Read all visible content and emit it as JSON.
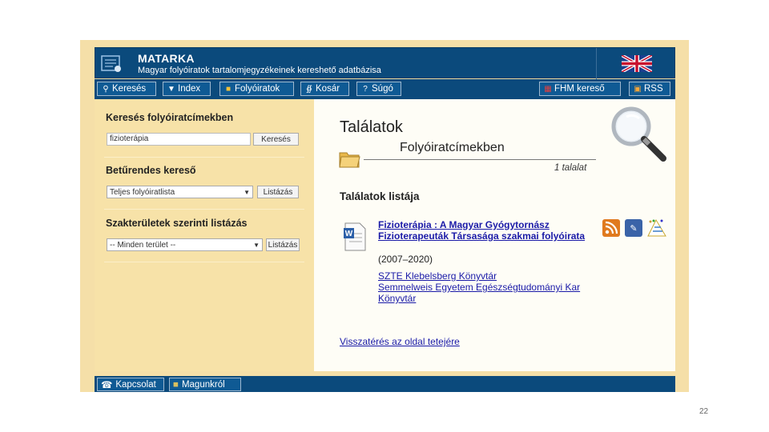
{
  "header": {
    "title": "MATARKA",
    "subtitle": "Magyar folyóiratok tartalomjegyzékeinek kereshető adatbázisa"
  },
  "nav": {
    "items": [
      {
        "label": "Keresés",
        "icon": "magnifier-icon"
      },
      {
        "label": "Index",
        "icon": "funnel-icon"
      },
      {
        "label": "Folyóiratok",
        "icon": "folder-icon"
      },
      {
        "label": "Kosár",
        "icon": "cart-icon"
      },
      {
        "label": "Súgó",
        "icon": "question-icon"
      }
    ],
    "right_items": [
      {
        "label": "FHM kereső",
        "icon": "fhm-icon"
      },
      {
        "label": "RSS",
        "icon": "rss-icon"
      }
    ]
  },
  "sidebar": {
    "search": {
      "title": "Keresés folyóiratcímekben",
      "input_value": "fizioterápia",
      "button": "Keresés"
    },
    "alpha": {
      "title": "Betűrendes kereső",
      "select_value": "Teljes folyóiratlista",
      "button": "Listázás"
    },
    "subject": {
      "title": "Szakterületek szerinti listázás",
      "select_value": "-- Minden terület --",
      "button": "Listázás"
    }
  },
  "main": {
    "title": "Találatok",
    "subtitle": "Folyóiratcímekben",
    "count": "1 talalat",
    "list_title": "Találatok listája",
    "result": {
      "title": "Fizioterápia : A Magyar Gyógytornász Fizioterapeuták Társasága szakmai folyóirata",
      "years": "(2007–2020)",
      "libraries": [
        "SZTE Klebelsberg Könyvtár",
        "Semmelweis Egyetem Egészségtudományi Kar Könyvtár"
      ]
    },
    "back_link": "Visszatérés az oldal tetejére"
  },
  "footer": {
    "items": [
      {
        "label": "Kapcsolat",
        "icon": "phone-icon"
      },
      {
        "label": "Magunkról",
        "icon": "info-icon"
      }
    ]
  },
  "page_number": "22",
  "colors": {
    "header_bg": "#0b4a7c",
    "sidebar_bg": "#f7e2a8",
    "main_bg": "#fefdf6",
    "link": "#1a1aa8"
  }
}
